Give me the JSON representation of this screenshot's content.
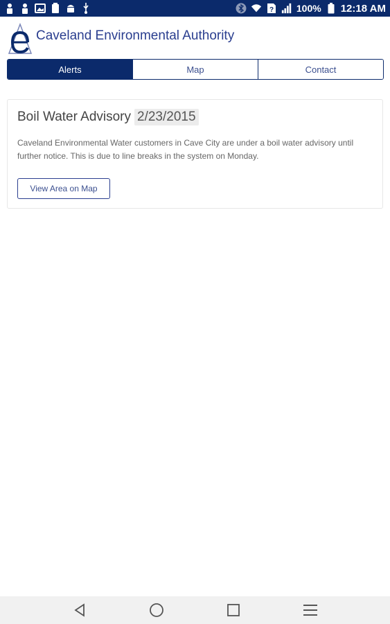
{
  "status_bar": {
    "battery_percent": "100%",
    "time": "12:18 AM",
    "left_icons": [
      "person-icon",
      "person-icon",
      "image-icon",
      "clipboard-icon",
      "android-icon",
      "usb-icon"
    ],
    "right_icons": [
      "bluetooth-icon",
      "wifi-icon",
      "sim-unknown-icon",
      "signal-icon",
      "battery-icon"
    ]
  },
  "header": {
    "title": "Caveland Environmental Authority",
    "logo_icon": "caveland-logo"
  },
  "tabs": [
    {
      "label": "Alerts",
      "active": true
    },
    {
      "label": "Map",
      "active": false
    },
    {
      "label": "Contact",
      "active": false
    }
  ],
  "alert": {
    "title": "Boil Water Advisory",
    "date": "2/23/2015",
    "body": "Caveland Environmental Water customers in Cave City are under a boil water advisory until further notice. This is due to line breaks in the system on Monday.",
    "button_label": "View Area on Map"
  },
  "nav_bar": {
    "buttons": [
      "back-icon",
      "home-icon",
      "recents-icon",
      "menu-icon"
    ]
  },
  "colors": {
    "primary": "#0b2a6b",
    "accent_text": "#2a3e8f"
  }
}
